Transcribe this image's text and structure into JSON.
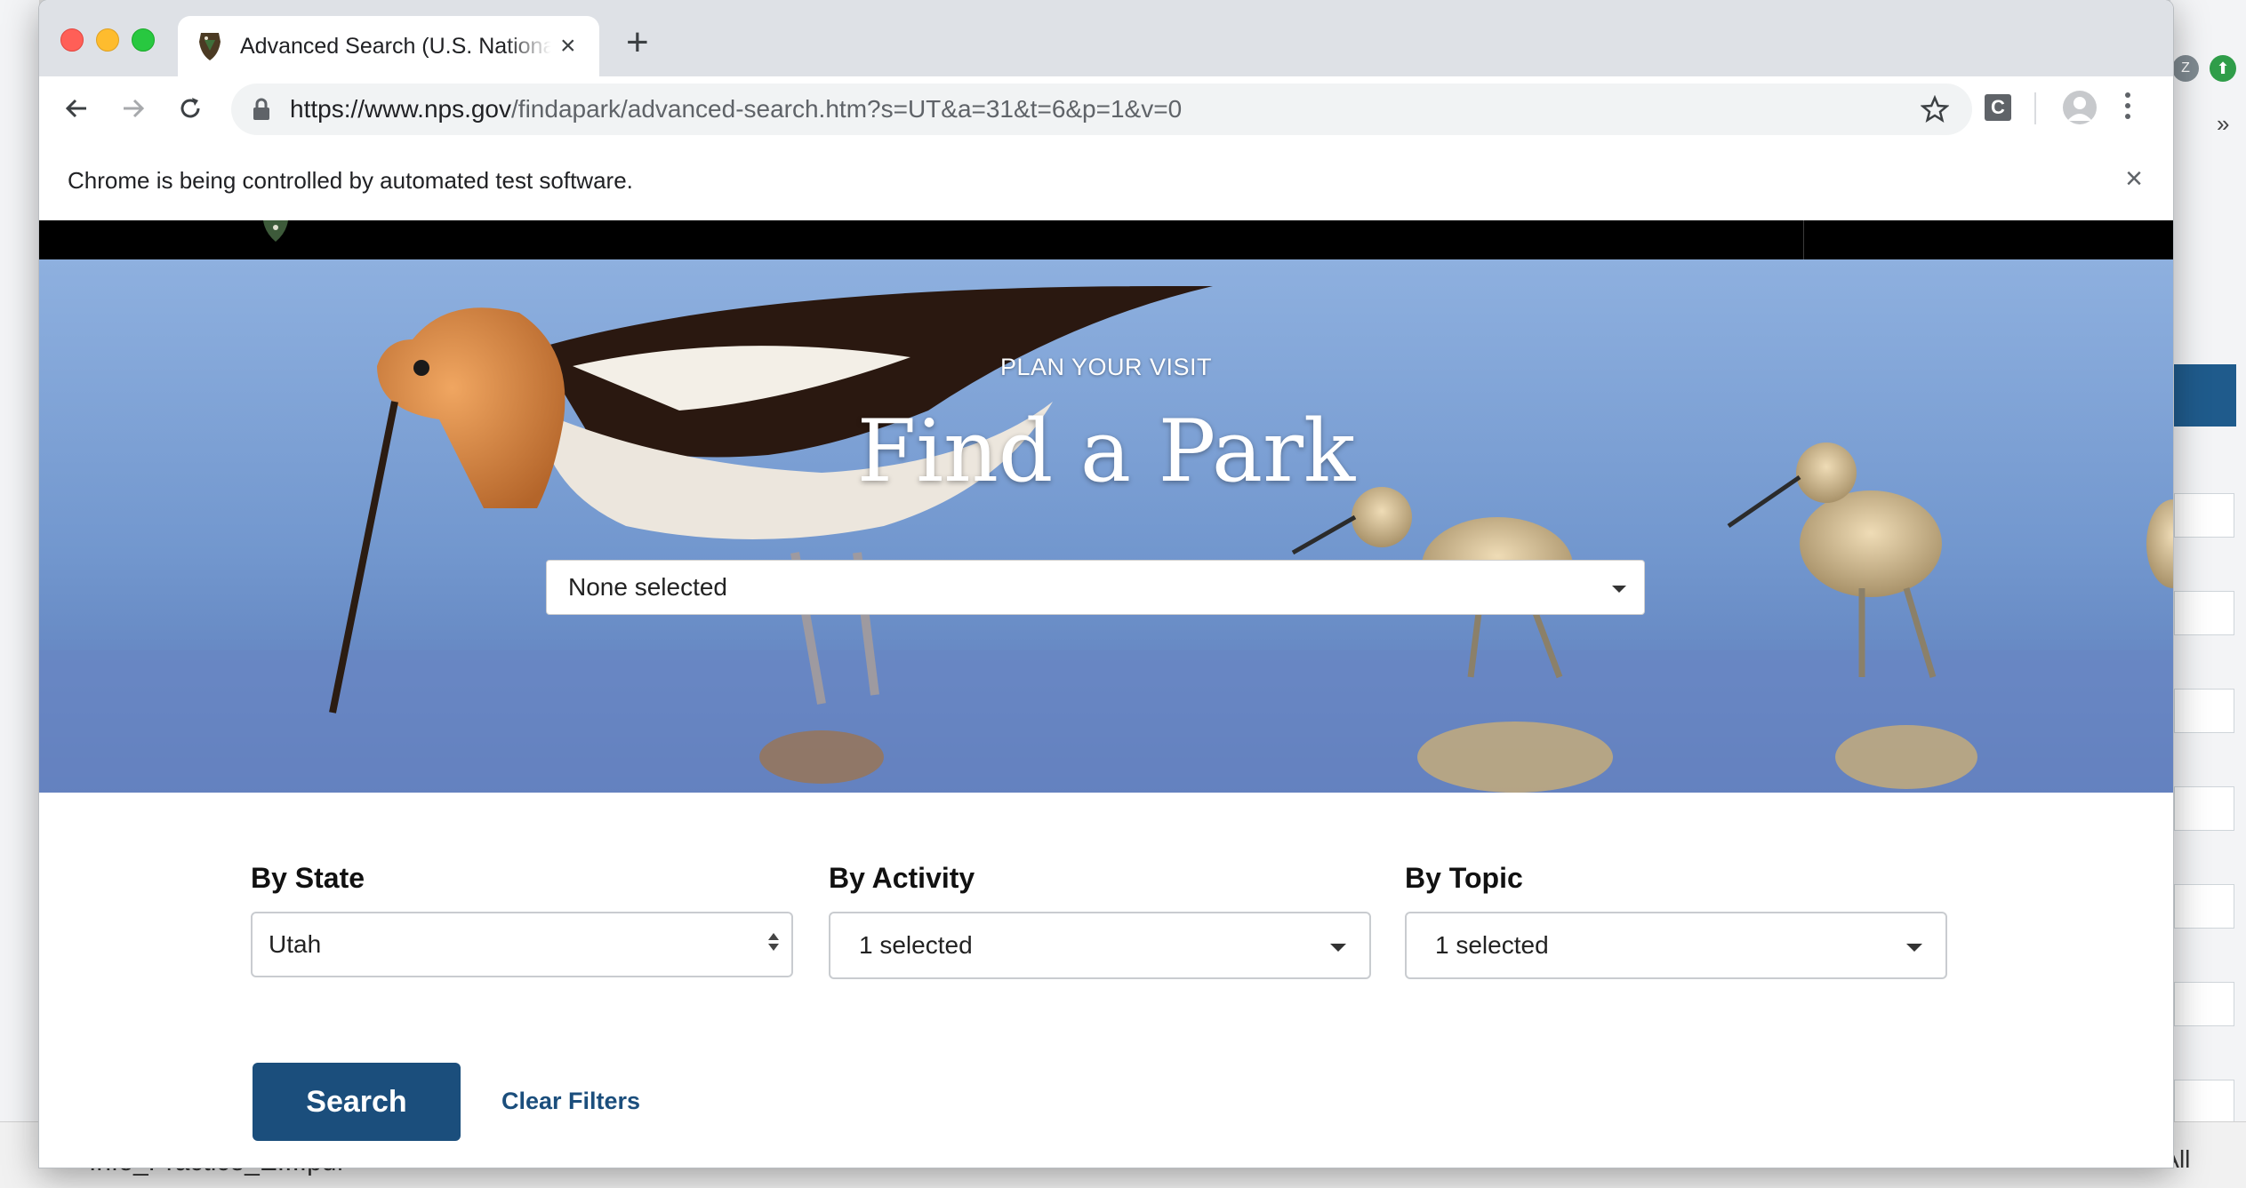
{
  "browser": {
    "tab_title": "Advanced Search (U.S. National Park Service)",
    "tab_close_label": "×",
    "new_tab_label": "+",
    "url_host": "https://www.nps.gov",
    "url_path": "/findapark/advanced-search.htm?s=UT&a=31&t=6&p=1&v=0",
    "extension_label": "C",
    "infobar_message": "Chrome is being controlled by automated test software.",
    "infobar_close": "×"
  },
  "hero": {
    "kicker": "PLAN YOUR VISIT",
    "title": "Find a Park",
    "park_select_value": "None selected"
  },
  "filters": {
    "state": {
      "label": "By State",
      "value": "Utah"
    },
    "activity": {
      "label": "By Activity",
      "value": "1 selected"
    },
    "topic": {
      "label": "By Topic",
      "value": "1 selected"
    }
  },
  "actions": {
    "search_label": "Search",
    "clear_label": "Clear Filters"
  },
  "background": {
    "download_file": "Info_Practice_E....pdf",
    "show_all": "Show All",
    "avatar_letter": "Z",
    "overflow_label": "»"
  },
  "colors": {
    "brand_blue": "#1b4e7c",
    "header_black": "#000000",
    "sky_blue": "#7da2d6"
  }
}
